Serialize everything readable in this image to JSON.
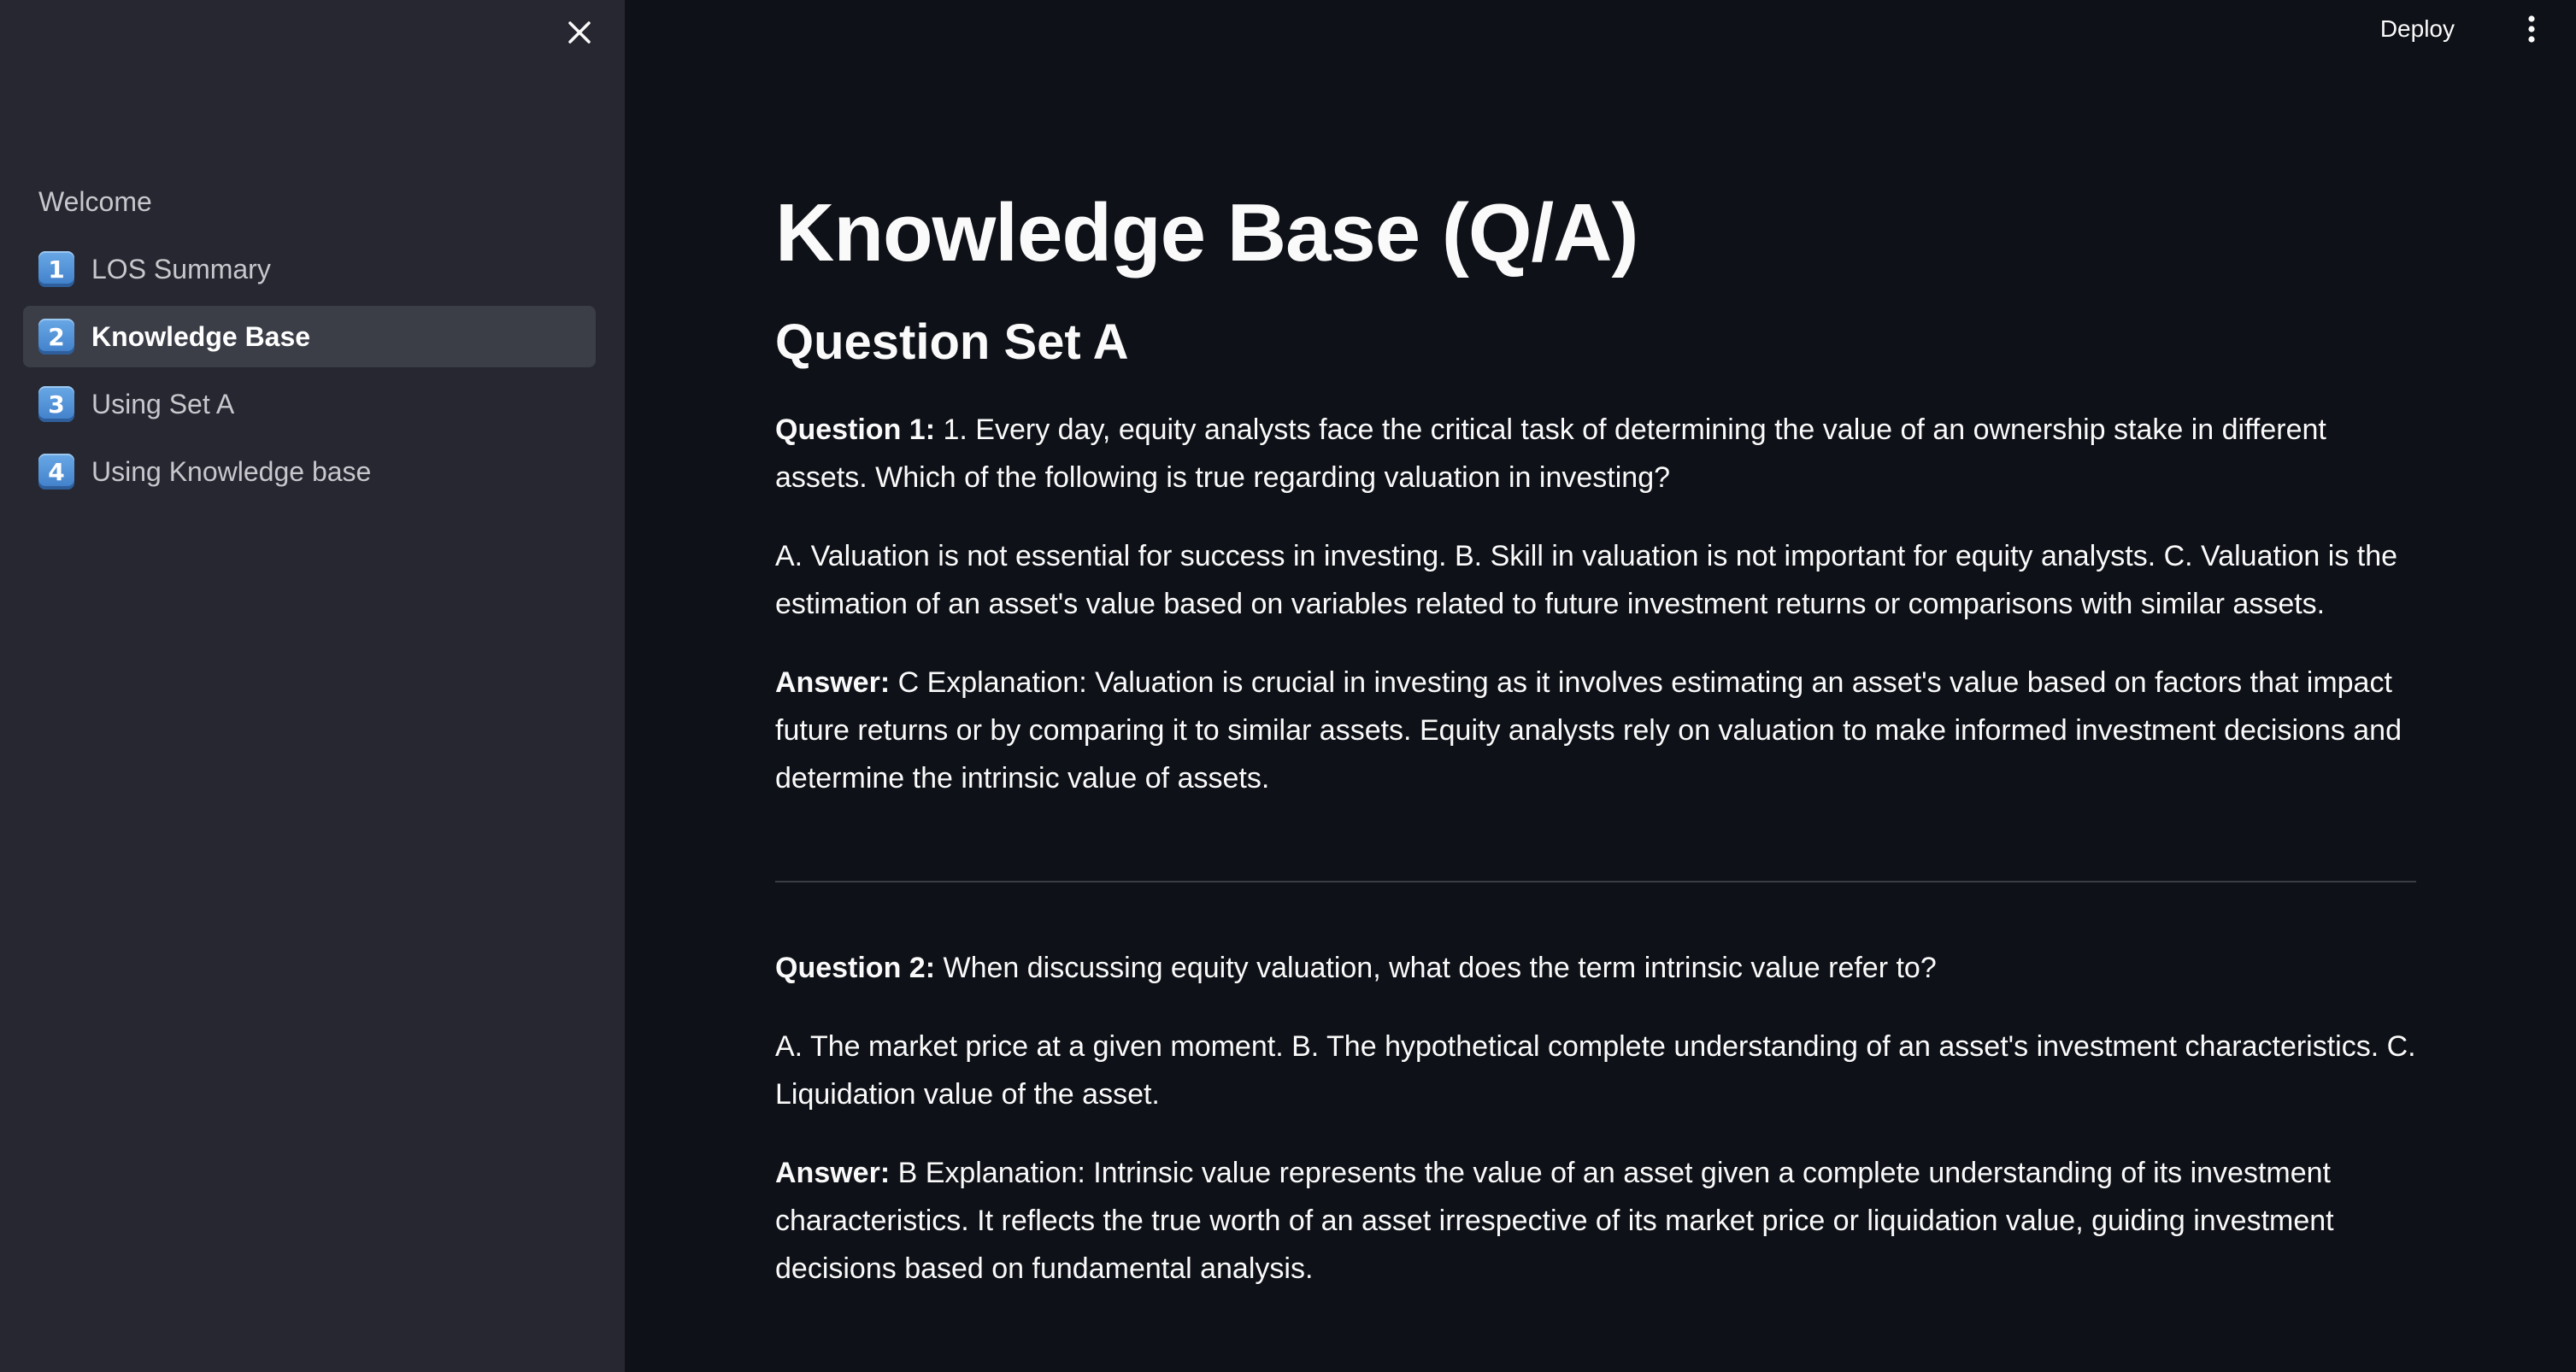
{
  "sidebar": {
    "welcome": "Welcome",
    "items": [
      {
        "number": "1",
        "label": "LOS Summary",
        "active": false
      },
      {
        "number": "2",
        "label": "Knowledge Base",
        "active": true
      },
      {
        "number": "3",
        "label": "Using Set A",
        "active": false
      },
      {
        "number": "4",
        "label": "Using Knowledge base",
        "active": false
      }
    ]
  },
  "topbar": {
    "deploy_label": "Deploy"
  },
  "main": {
    "title": "Knowledge Base (Q/A)",
    "section_title": "Question Set A",
    "questions": [
      {
        "question_label": "Question 1:",
        "question_text": " 1. Every day, equity analysts face the critical task of determining the value of an ownership stake in different assets. Which of the following is true regarding valuation in investing?",
        "options_text": "A. Valuation is not essential for success in investing. B. Skill in valuation is not important for equity analysts. C. Valuation is the estimation of an asset's value based on variables related to future investment returns or comparisons with similar assets.",
        "answer_label": "Answer:",
        "answer_text": " C Explanation: Valuation is crucial in investing as it involves estimating an asset's value based on factors that impact future returns or by comparing it to similar assets. Equity analysts rely on valuation to make informed investment decisions and determine the intrinsic value of assets."
      },
      {
        "question_label": "Question 2:",
        "question_text": " When discussing equity valuation, what does the term intrinsic value refer to?",
        "options_text": "A. The market price at a given moment. B. The hypothetical complete understanding of an asset's investment characteristics. C. Liquidation value of the asset.",
        "answer_label": "Answer:",
        "answer_text": " B Explanation: Intrinsic value represents the value of an asset given a complete understanding of its investment characteristics. It reflects the true worth of an asset irrespective of its market price or liquidation value, guiding investment decisions based on fundamental analysis."
      }
    ]
  },
  "colors": {
    "sidebar_bg": "#262730",
    "main_bg": "#0e1117",
    "active_item_bg": "#3b3d47",
    "keycap_blue": "#4a8fd8"
  },
  "icons": {
    "close": "close-icon",
    "menu": "more-vertical-icon",
    "keycap": "keycap-number-icon"
  }
}
